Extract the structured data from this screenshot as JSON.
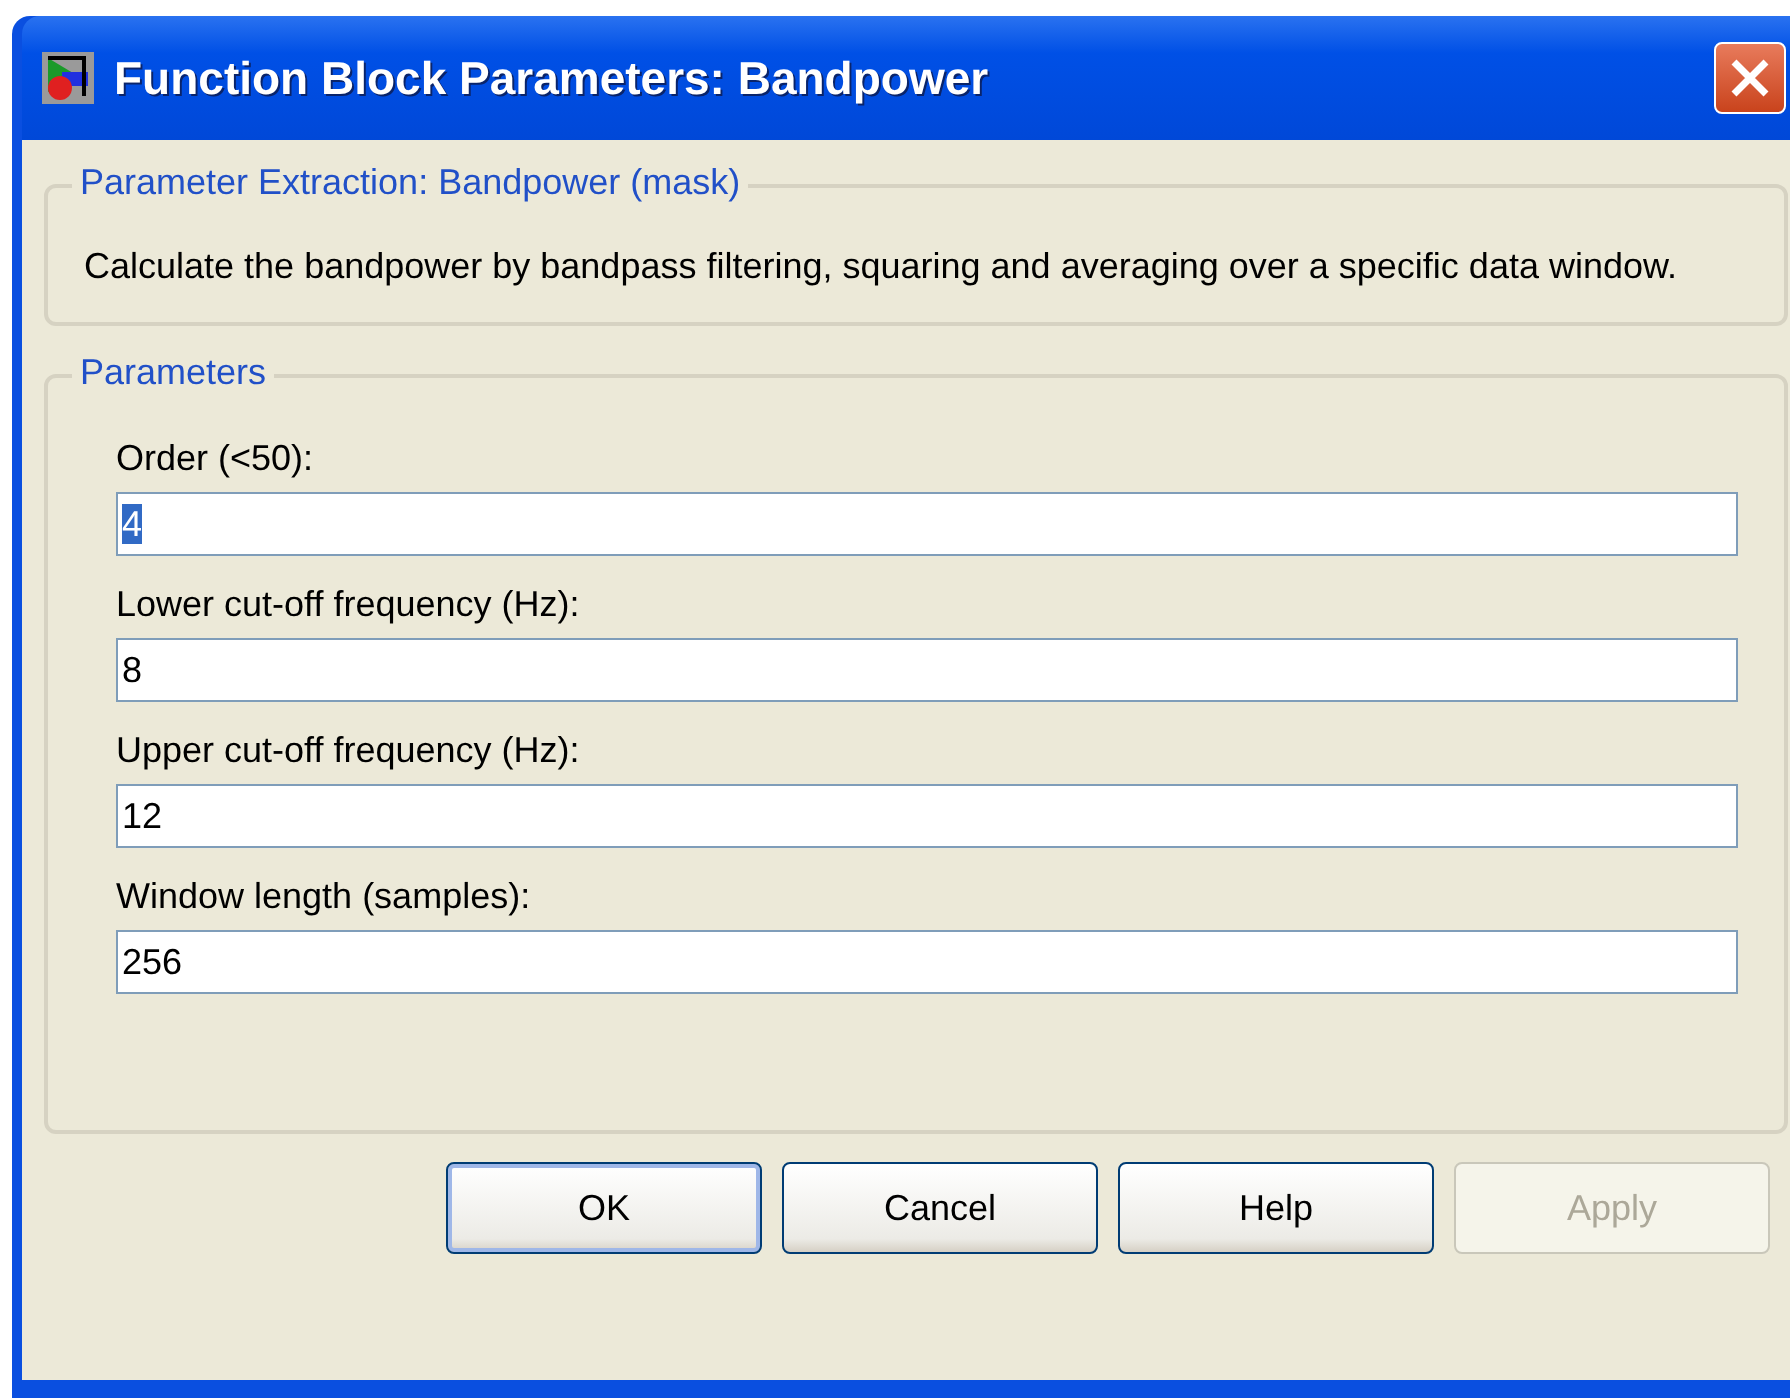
{
  "window": {
    "title": "Function Block Parameters: Bandpower"
  },
  "description_group": {
    "title": "Parameter Extraction: Bandpower (mask)",
    "text": "Calculate the bandpower by bandpass filtering, squaring and averaging over a specific data window."
  },
  "parameters_group": {
    "title": "Parameters",
    "fields": [
      {
        "label": "Order (<50):",
        "value": "4",
        "selected": true
      },
      {
        "label": "Lower cut-off frequency (Hz):",
        "value": "8",
        "selected": false
      },
      {
        "label": "Upper cut-off frequency (Hz):",
        "value": "12",
        "selected": false
      },
      {
        "label": "Window length (samples):",
        "value": "256",
        "selected": false
      }
    ]
  },
  "buttons": [
    {
      "label": "OK",
      "default": true,
      "disabled": false
    },
    {
      "label": "Cancel",
      "default": false,
      "disabled": false
    },
    {
      "label": "Help",
      "default": false,
      "disabled": false
    },
    {
      "label": "Apply",
      "default": false,
      "disabled": true
    }
  ]
}
